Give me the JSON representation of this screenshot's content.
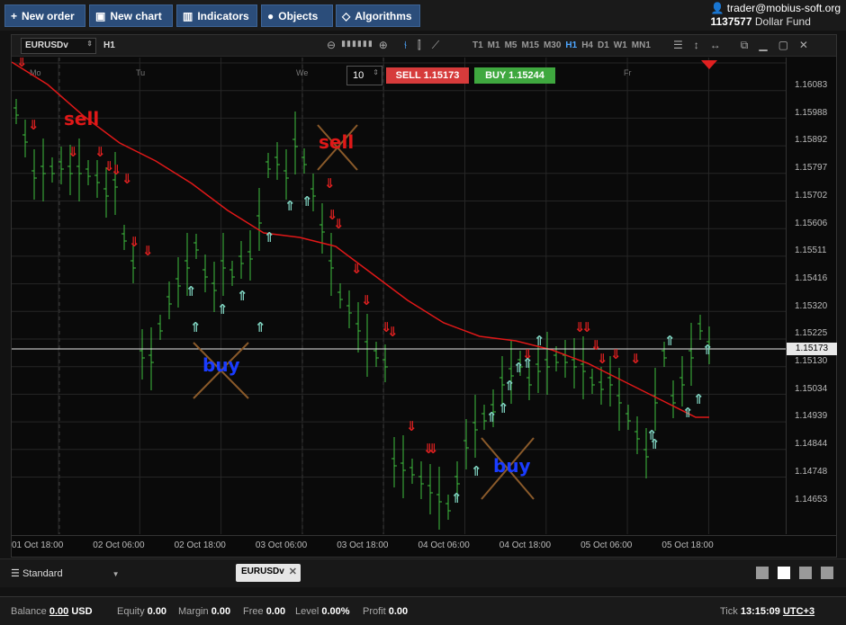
{
  "toolbar": {
    "buttons": [
      {
        "label": "New order",
        "icon": "plus-icon"
      },
      {
        "label": "New chart",
        "icon": "chart-icon"
      },
      {
        "label": "Indicators",
        "icon": "bars-icon"
      },
      {
        "label": "Objects",
        "icon": "shapes-icon"
      },
      {
        "label": "Algorithms",
        "icon": "diamond-icon"
      }
    ]
  },
  "account": {
    "email": "trader@mobius-soft.org",
    "number": "1137577",
    "type": "Dollar Fund"
  },
  "chart": {
    "symbol": "EURUSDv",
    "timeframe": "H1",
    "timeframes": [
      "T1",
      "M1",
      "M5",
      "M15",
      "M30",
      "H1",
      "H4",
      "D1",
      "W1",
      "MN1"
    ],
    "active_timeframe": "H1",
    "lot": "10",
    "sell_label": "SELL 1.15173",
    "buy_label": "BUY 1.15244",
    "price_labels": [
      "1.16083",
      "1.15988",
      "1.15892",
      "1.15797",
      "1.15702",
      "1.15606",
      "1.15511",
      "1.15416",
      "1.15320",
      "1.15225",
      "1.15130",
      "1.15034",
      "1.14939",
      "1.14844",
      "1.14748",
      "1.14653"
    ],
    "current_price": "1.15173",
    "time_labels": [
      "01 Oct 18:00",
      "02 Oct 06:00",
      "02 Oct 18:00",
      "03 Oct 06:00",
      "03 Oct 18:00",
      "04 Oct 06:00",
      "04 Oct 18:00",
      "05 Oct 06:00",
      "05 Oct 18:00"
    ],
    "day_labels": [
      "Mo",
      "Tu",
      "We",
      "Fr"
    ],
    "annotations": {
      "sell1": "sell",
      "sell2": "sell",
      "buy1": "buy",
      "buy2": "buy"
    },
    "colors": {
      "bull": "#3fbf3f",
      "bear": "#e02020",
      "ma": "#e01818",
      "buy_text": "#1a3cff",
      "sell_text": "#e01818"
    }
  },
  "tabbar": {
    "layout": "Standard",
    "symbol_tab": "EURUSDv"
  },
  "status": {
    "balance_label": "Balance",
    "balance": "0.00",
    "currency": "USD",
    "equity_label": "Equity",
    "equity": "0.00",
    "margin_label": "Margin",
    "margin": "0.00",
    "free_label": "Free",
    "free": "0.00",
    "level_label": "Level",
    "level": "0.00%",
    "profit_label": "Profit",
    "profit": "0.00",
    "tick_label": "Tick",
    "time": "13:15:09",
    "tz": "UTC+3"
  }
}
